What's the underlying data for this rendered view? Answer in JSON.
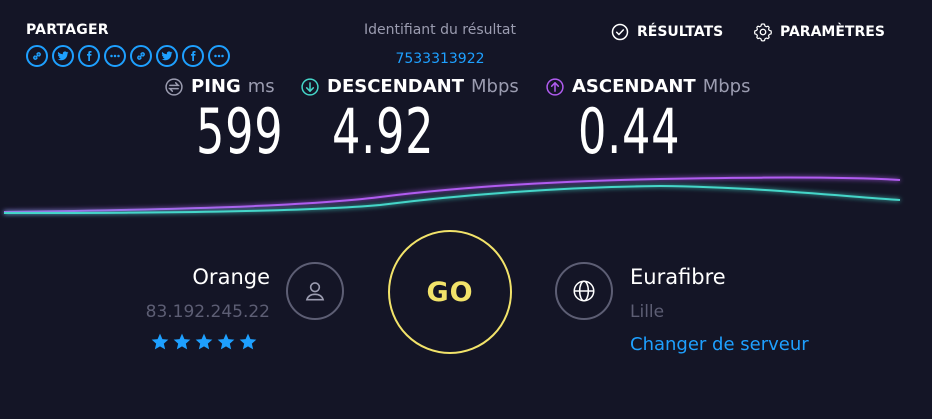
{
  "share": {
    "label": "PARTAGER",
    "icons": [
      "link-icon",
      "twitter-icon",
      "facebook-icon",
      "more-icon",
      "link-icon",
      "twitter-icon",
      "facebook-icon",
      "more-icon"
    ]
  },
  "result": {
    "id_label": "Identifiant du résultat",
    "id_value": "7533313922"
  },
  "nav": {
    "results_label": "RÉSULTATS",
    "settings_label": "PARAMÈTRES"
  },
  "metrics": {
    "ping": {
      "label": "PING",
      "unit": "ms",
      "value": "599"
    },
    "download": {
      "label": "DESCENDANT",
      "unit": "Mbps",
      "value": "4.92"
    },
    "upload": {
      "label": "ASCENDANT",
      "unit": "Mbps",
      "value": "0.44"
    }
  },
  "colors": {
    "accent": "#1ea0ff",
    "go": "#f2e36a",
    "download_line": "#45d6c9",
    "upload_line": "#b05cf0",
    "background": "#141526"
  },
  "isp": {
    "name": "Orange",
    "ip": "83.192.245.22",
    "rating": 5
  },
  "go_label": "GO",
  "server": {
    "name": "Eurafibre",
    "city": "Lille",
    "change_label": "Changer de serveur"
  }
}
